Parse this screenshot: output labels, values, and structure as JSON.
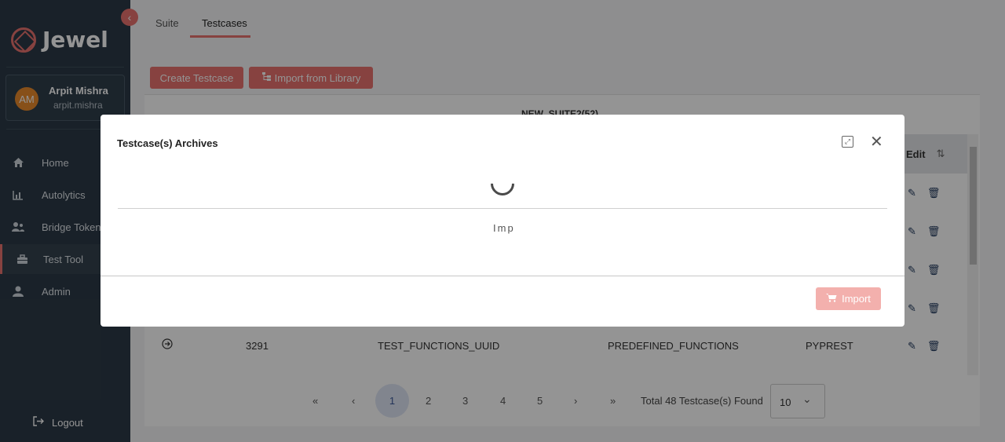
{
  "app": {
    "name": "Jewel"
  },
  "user": {
    "initials": "AM",
    "name": "Arpit Mishra",
    "username": "arpit.mishra"
  },
  "sidebar": {
    "items": [
      {
        "label": "Home",
        "icon": "home-icon"
      },
      {
        "label": "Autolytics",
        "icon": "chart-icon"
      },
      {
        "label": "Bridge Token",
        "icon": "users-icon"
      },
      {
        "label": "Test Tool",
        "icon": "toolbox-icon",
        "active": true
      },
      {
        "label": "Admin",
        "icon": "user-icon"
      }
    ],
    "logout": "Logout"
  },
  "tabs": [
    {
      "label": "Suite"
    },
    {
      "label": "Testcases",
      "active": true
    }
  ],
  "actions": {
    "create": "Create Testcase",
    "import_library": "Import from Library"
  },
  "suite": {
    "title": "NEW_SUITE2(52)"
  },
  "table": {
    "edit_header": "Edit",
    "visible_row": {
      "id": "3291",
      "name": "TEST_FUNCTIONS_UUID",
      "category": "PREDEFINED_FUNCTIONS",
      "framework": "PYPREST"
    }
  },
  "pagination": {
    "first": "«",
    "prev": "‹",
    "pages": [
      "1",
      "2",
      "3",
      "4",
      "5"
    ],
    "current": "1",
    "next": "›",
    "last": "»",
    "total": "Total 48 Testcase(s) Found",
    "page_size": "10"
  },
  "modal": {
    "title": "Testcase(s) Archives",
    "loading_text": "Imp",
    "import_label": "Import"
  },
  "colors": {
    "accent": "#e8736f",
    "sidebar": "#2c3a47",
    "import_disabled": "#f3b0ad"
  }
}
